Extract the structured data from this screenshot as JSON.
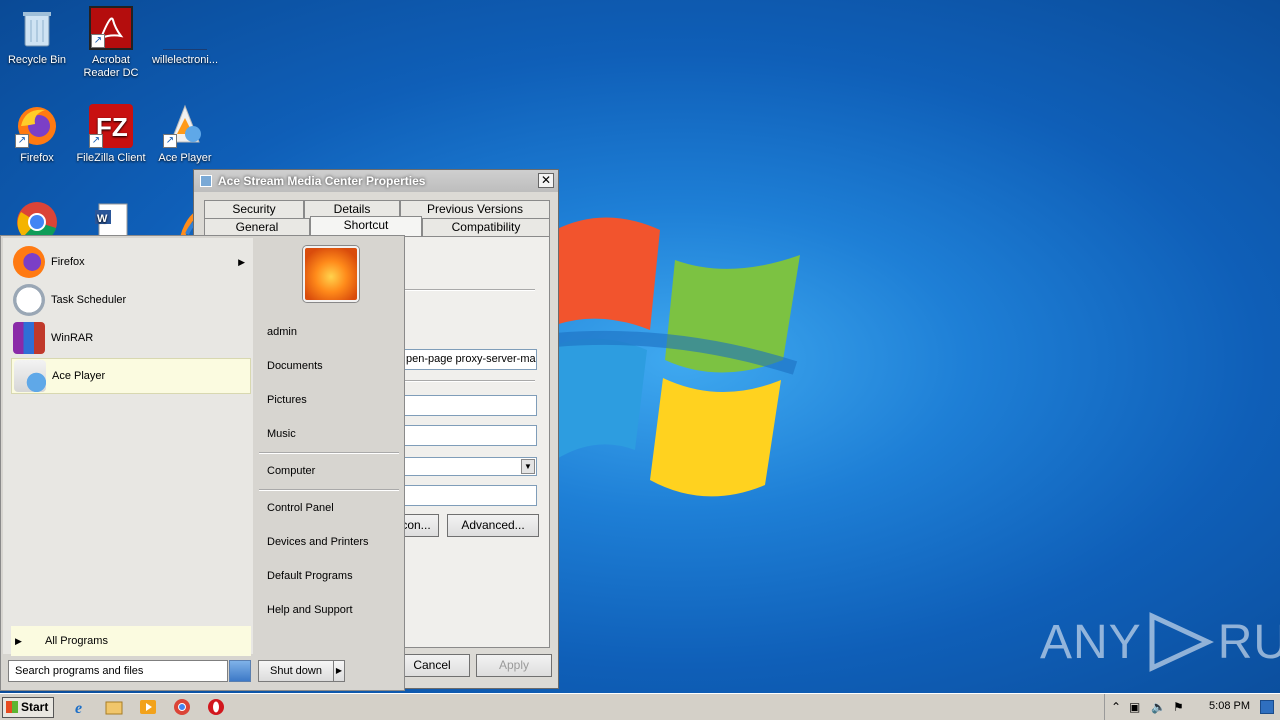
{
  "desktop": {
    "icons": [
      {
        "label": "Recycle Bin"
      },
      {
        "label": "Acrobat Reader DC"
      },
      {
        "label": "willelectroni..."
      },
      {
        "label": "Firefox"
      },
      {
        "label": "FileZilla Client"
      },
      {
        "label": "Ace Player"
      }
    ]
  },
  "dialog": {
    "title": "Ace Stream Media Center Properties",
    "close": "✕",
    "tabs_row1": [
      "Security",
      "Details",
      "Previous Versions"
    ],
    "tabs_row2": [
      "General",
      "Shortcut",
      "Compatibility"
    ],
    "target_value": "pen-page proxy-server-main",
    "change_icon_label": "con...",
    "advanced_label": "Advanced...",
    "cancel_label": "Cancel",
    "apply_label": "Apply"
  },
  "start_menu": {
    "programs": [
      {
        "label": "Firefox",
        "has_submenu": true
      },
      {
        "label": "Task Scheduler",
        "has_submenu": false
      },
      {
        "label": "WinRAR",
        "has_submenu": false
      },
      {
        "label": "Ace Player",
        "has_submenu": false
      }
    ],
    "all_programs": "All Programs",
    "search_placeholder": "Search programs and files",
    "right_items": {
      "user": "admin",
      "documents": "Documents",
      "pictures": "Pictures",
      "music": "Music",
      "computer": "Computer",
      "control_panel": "Control Panel",
      "devices": "Devices and Printers",
      "default_programs": "Default Programs",
      "help": "Help and Support"
    },
    "shutdown": "Shut down"
  },
  "taskbar": {
    "start": "Start",
    "clock": "5:08 PM"
  },
  "watermark": {
    "left": "ANY",
    "right": "RUN"
  }
}
